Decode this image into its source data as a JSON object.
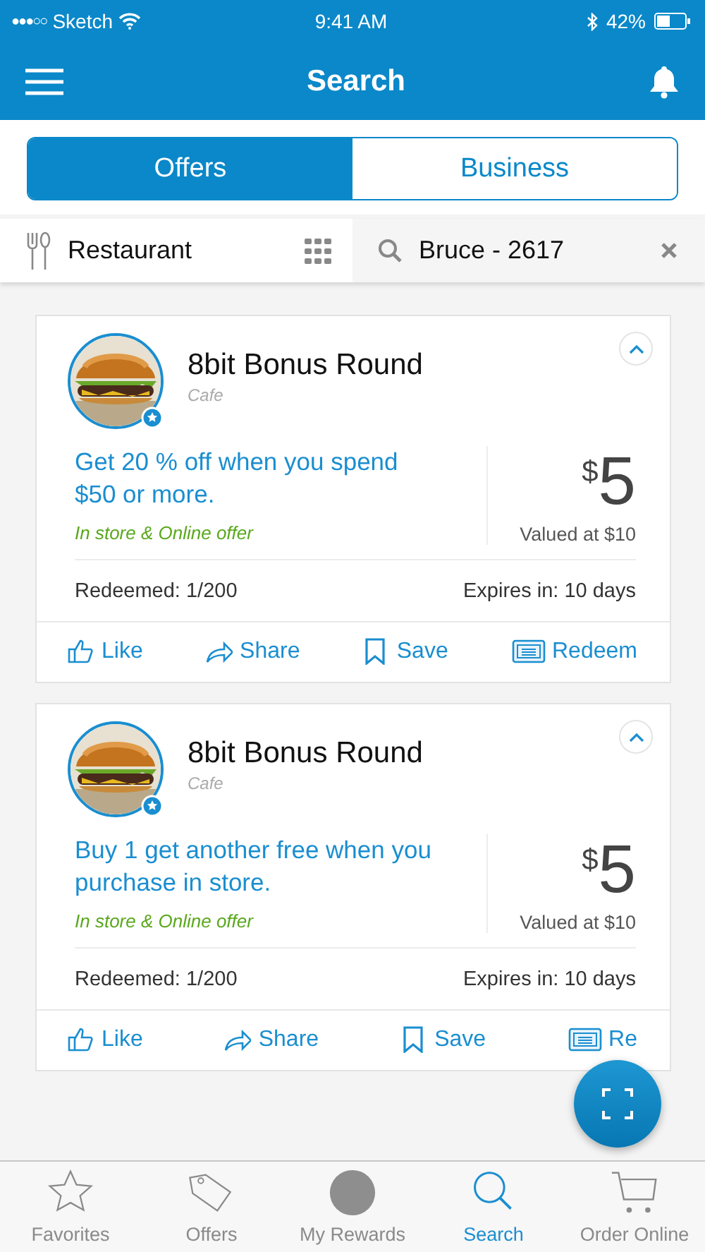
{
  "status_bar": {
    "signal": "●●●○○",
    "carrier": "Sketch",
    "time": "9:41 AM",
    "battery": "42%"
  },
  "header": {
    "title": "Search"
  },
  "segments": [
    {
      "label": "Offers",
      "selected": true
    },
    {
      "label": "Business",
      "selected": false
    }
  ],
  "filter": {
    "category": "Restaurant",
    "search_value": "Bruce - 2617"
  },
  "offers": [
    {
      "name": "8bit Bonus Round",
      "type": "Cafe",
      "expanded": true,
      "description": "Get 20 % off when you spend $50 or more.",
      "channel": "In store & Online offer",
      "currency": "$",
      "amount": "5",
      "valued": "Valued at $10",
      "redeemed": "Redeemed: 1/200",
      "expires": "Expires in: 10 days",
      "actions": [
        {
          "kind": "like",
          "label": "Like"
        },
        {
          "kind": "share",
          "label": "Share"
        },
        {
          "kind": "save",
          "label": "Save"
        },
        {
          "kind": "redeem",
          "label": "Redeem"
        }
      ]
    },
    {
      "name": "8bit Bonus Round",
      "type": "Cafe",
      "expanded": true,
      "description": "Buy 1 get another free when you purchase in store.",
      "channel": "In store & Online offer",
      "currency": "$",
      "amount": "5",
      "valued": "Valued at $10",
      "redeemed": "Redeemed: 1/200",
      "expires": "Expires in: 10 days",
      "actions": [
        {
          "kind": "like",
          "label": "Like"
        },
        {
          "kind": "share",
          "label": "Share"
        },
        {
          "kind": "save",
          "label": "Save"
        },
        {
          "kind": "redeem",
          "label": "Re"
        }
      ]
    }
  ],
  "tabs": [
    {
      "kind": "favorites",
      "label": "Favorites",
      "selected": false
    },
    {
      "kind": "offers",
      "label": "Offers",
      "selected": false
    },
    {
      "kind": "rewards",
      "label": "My Rewards",
      "selected": false
    },
    {
      "kind": "search",
      "label": "Search",
      "selected": true
    },
    {
      "kind": "cart",
      "label": "Order Online",
      "selected": false
    }
  ]
}
